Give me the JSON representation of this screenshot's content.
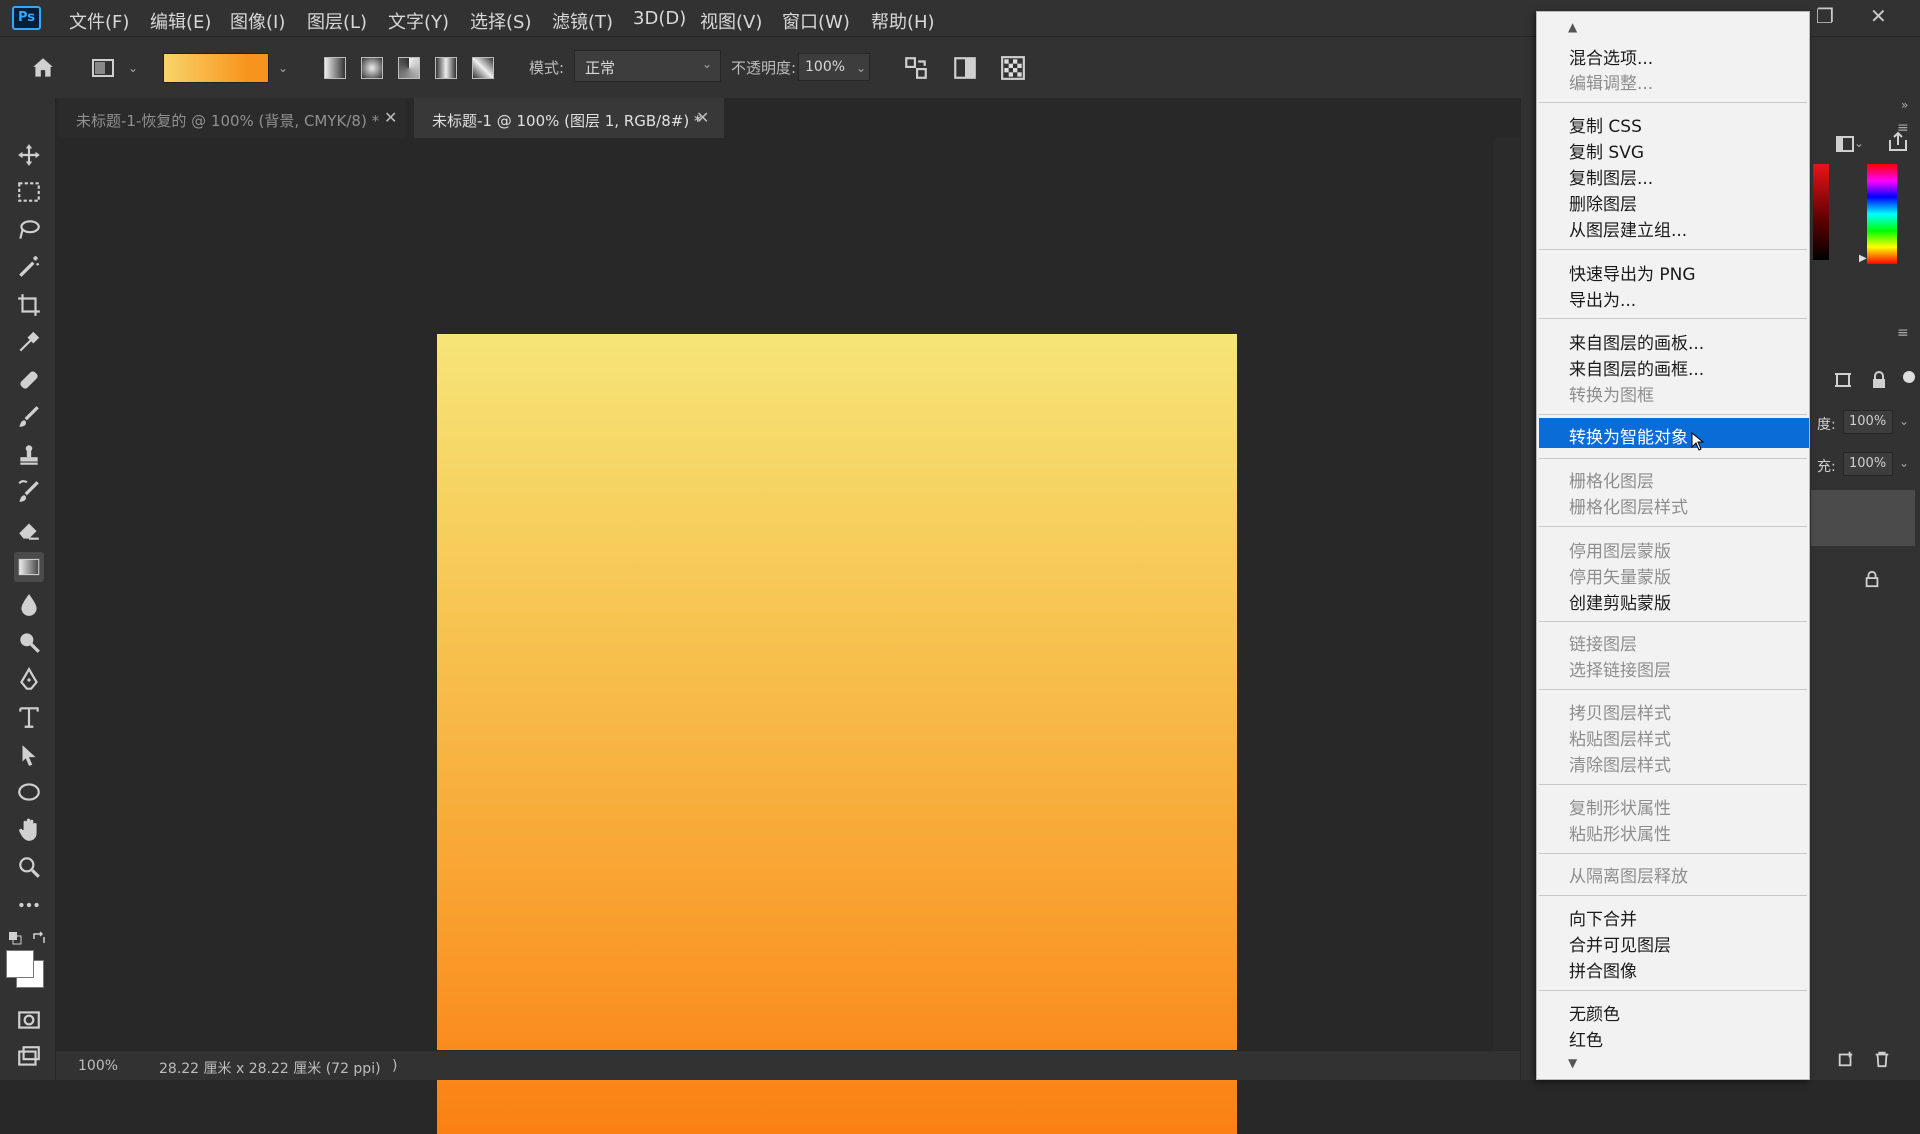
{
  "app": {
    "logo": "Ps",
    "menus": [
      "文件(F)",
      "编辑(E)",
      "图像(I)",
      "图层(L)",
      "文字(Y)",
      "选择(S)",
      "滤镜(T)",
      "3D(D)",
      "视图(V)",
      "窗口(W)",
      "帮助(H)"
    ]
  },
  "options": {
    "mode_label": "模式:",
    "mode_value": "正常",
    "opacity_label": "不透明度:",
    "opacity_value": "100%",
    "gradient_colors": [
      "#f9d46a",
      "#f7941d"
    ]
  },
  "tabs": [
    {
      "label": "未标题-1-恢复的 @ 100% (背景, CMYK/8) *",
      "active": false
    },
    {
      "label": "未标题-1 @ 100% (图层 1, RGB/8#) *",
      "active": true
    }
  ],
  "canvas": {
    "gradient_top": "#f6e577",
    "gradient_bottom": "#fb8013"
  },
  "status": {
    "zoom": "100%",
    "doc_size": "28.22 厘米 x 28.22 厘米 (72 ppi)",
    "arrow": ")"
  },
  "right_panel": {
    "opacity_label": "度:",
    "opacity_value": "100%",
    "fill_label": "充:",
    "fill_value": "100%"
  },
  "context_menu": {
    "items": [
      {
        "label": "混合选项...",
        "enabled": true
      },
      {
        "label": "编辑调整...",
        "enabled": false
      },
      {
        "label": "复制 CSS",
        "enabled": true
      },
      {
        "label": "复制 SVG",
        "enabled": true
      },
      {
        "label": "复制图层...",
        "enabled": true
      },
      {
        "label": "删除图层",
        "enabled": true
      },
      {
        "label": "从图层建立组...",
        "enabled": true
      },
      {
        "label": "快速导出为 PNG",
        "enabled": true
      },
      {
        "label": "导出为...",
        "enabled": true
      },
      {
        "label": "来自图层的画板...",
        "enabled": true
      },
      {
        "label": "来自图层的画框...",
        "enabled": true
      },
      {
        "label": "转换为图框",
        "enabled": false
      },
      {
        "label": "转换为智能对象",
        "enabled": true,
        "highlighted": true
      },
      {
        "label": "栅格化图层",
        "enabled": false
      },
      {
        "label": "栅格化图层样式",
        "enabled": false
      },
      {
        "label": "停用图层蒙版",
        "enabled": false
      },
      {
        "label": "停用矢量蒙版",
        "enabled": false
      },
      {
        "label": "创建剪贴蒙版",
        "enabled": true
      },
      {
        "label": "链接图层",
        "enabled": false
      },
      {
        "label": "选择链接图层",
        "enabled": false
      },
      {
        "label": "拷贝图层样式",
        "enabled": false
      },
      {
        "label": "粘贴图层样式",
        "enabled": false
      },
      {
        "label": "清除图层样式",
        "enabled": false
      },
      {
        "label": "复制形状属性",
        "enabled": false
      },
      {
        "label": "粘贴形状属性",
        "enabled": false
      },
      {
        "label": "从隔离图层释放",
        "enabled": false
      },
      {
        "label": "向下合并",
        "enabled": true
      },
      {
        "label": "合并可见图层",
        "enabled": true
      },
      {
        "label": "拼合图像",
        "enabled": true
      },
      {
        "label": "无颜色",
        "enabled": true
      },
      {
        "label": "红色",
        "enabled": true
      }
    ]
  }
}
